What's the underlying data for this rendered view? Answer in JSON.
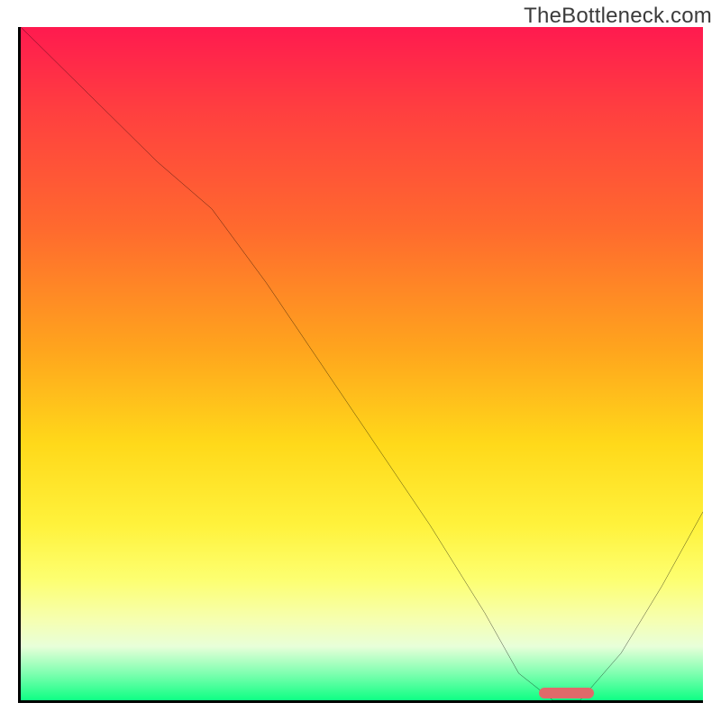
{
  "watermark": "TheBottleneck.com",
  "colors": {
    "top": "#ff1a4f",
    "mid": "#ffd91a",
    "bottom": "#0fff84",
    "curve": "#000000",
    "marker": "#e06a6a",
    "axis": "#000000"
  },
  "chart_data": {
    "type": "line",
    "title": "",
    "xlabel": "",
    "ylabel": "",
    "xlim": [
      0,
      100
    ],
    "ylim": [
      0,
      100
    ],
    "x": [
      0,
      10,
      20,
      28,
      36,
      44,
      52,
      60,
      68,
      73,
      78,
      82,
      88,
      94,
      100
    ],
    "values": [
      100,
      90,
      80,
      73,
      62,
      50,
      38,
      26,
      13,
      4,
      0,
      0,
      7,
      17,
      28
    ],
    "optimal_range_x": [
      76,
      84
    ],
    "annotations": []
  }
}
